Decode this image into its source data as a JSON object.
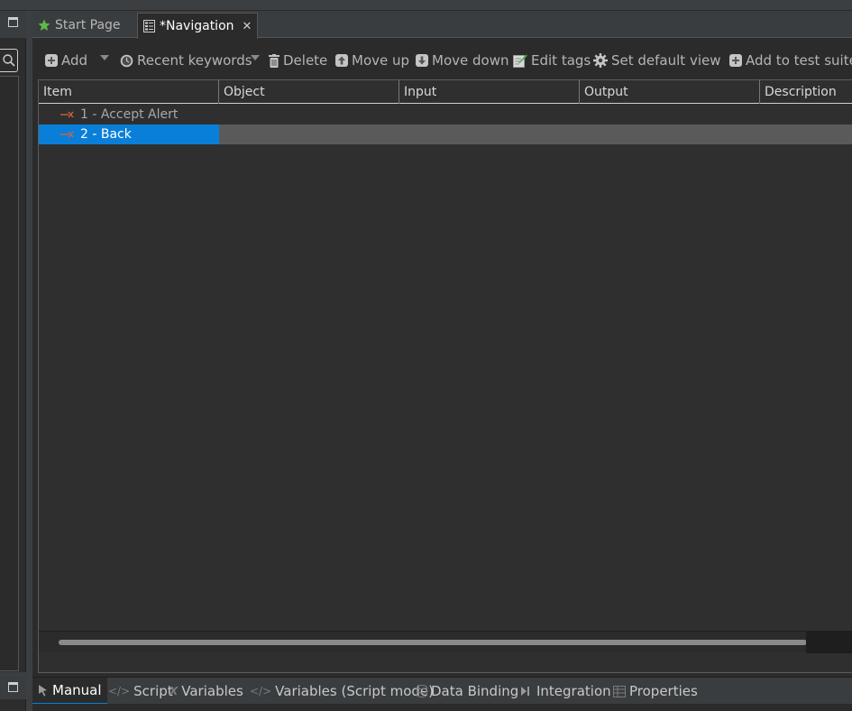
{
  "editor": {
    "tabs": [
      {
        "label": "Start Page",
        "icon": "star-icon"
      },
      {
        "label": "*Navigation",
        "icon": "document-icon",
        "active": true
      }
    ]
  },
  "toolbar": {
    "add": "Add",
    "recent_keywords": "Recent keywords",
    "delete": "Delete",
    "move_up": "Move up",
    "move_down": "Move down",
    "edit_tags": "Edit tags",
    "set_default_view": "Set default view",
    "add_to_test_suite": "Add to test suite"
  },
  "table": {
    "columns": [
      "Item",
      "Object",
      "Input",
      "Output",
      "Description"
    ],
    "rows": [
      {
        "label": "1 - Accept Alert"
      },
      {
        "label": "2 - Back",
        "selected": true
      }
    ]
  },
  "bottom_tabs": [
    {
      "label": "Manual",
      "active": true
    },
    {
      "label": "Script"
    },
    {
      "label": "Variables"
    },
    {
      "label": "Variables (Script mode)"
    },
    {
      "label": "Data Binding"
    },
    {
      "label": "Integration"
    },
    {
      "label": "Properties"
    }
  ],
  "colors": {
    "selection": "#0a7fd9",
    "background": "#2b2b2b",
    "keyword_icon": "#d9623a",
    "star": "#5fb948"
  }
}
